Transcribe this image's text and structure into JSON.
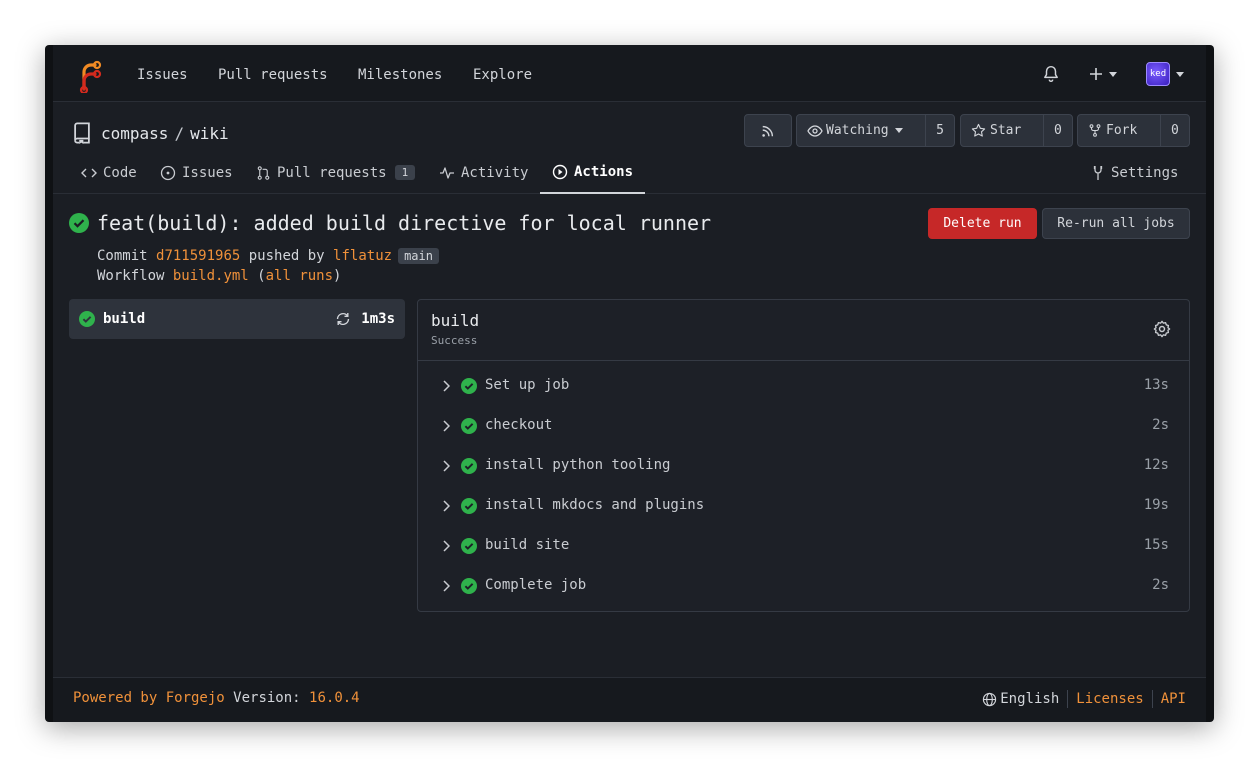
{
  "nav": {
    "items": [
      "Issues",
      "Pull requests",
      "Milestones",
      "Explore"
    ],
    "avatar_text": "ked"
  },
  "repo": {
    "owner": "compass",
    "separator": "/",
    "name": "wiki",
    "watch_label": "Watching",
    "watch_count": "5",
    "star_label": "Star",
    "star_count": "0",
    "fork_label": "Fork",
    "fork_count": "0"
  },
  "tabs": {
    "code": "Code",
    "issues": "Issues",
    "pulls": "Pull requests",
    "pulls_count": "1",
    "activity": "Activity",
    "actions": "Actions",
    "settings": "Settings"
  },
  "run": {
    "title": "feat(build): added build directive for local runner",
    "commit_label": "Commit",
    "commit_sha": "d711591965",
    "pushed_by_label": "pushed by",
    "author": "lflatuz",
    "branch": "main",
    "workflow_label": "Workflow",
    "workflow_file": "build.yml",
    "open_paren": "(",
    "all_runs": "all runs",
    "close_paren": ")",
    "delete_label": "Delete run",
    "rerun_label": "Re-run all jobs"
  },
  "jobs": [
    {
      "name": "build",
      "duration": "1m3s"
    }
  ],
  "job_detail": {
    "name": "build",
    "status": "Success",
    "steps": [
      {
        "name": "Set up job",
        "duration": "13s"
      },
      {
        "name": "checkout",
        "duration": "2s"
      },
      {
        "name": "install python tooling",
        "duration": "12s"
      },
      {
        "name": "install mkdocs and plugins",
        "duration": "19s"
      },
      {
        "name": "build site",
        "duration": "15s"
      },
      {
        "name": "Complete job",
        "duration": "2s"
      }
    ]
  },
  "footer": {
    "powered_by": "Powered by Forgejo",
    "version_label": "Version:",
    "version": "16.0.4",
    "language": "English",
    "licenses": "Licenses",
    "api": "API"
  },
  "colors": {
    "accent": "#f0913a",
    "success": "#2fb24c",
    "danger": "#c62828"
  }
}
